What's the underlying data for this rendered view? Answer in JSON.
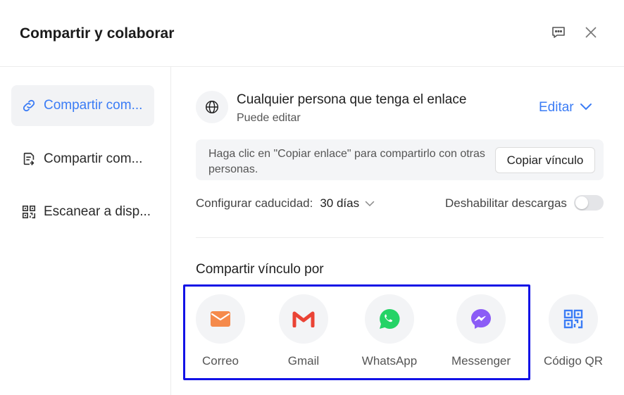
{
  "header": {
    "title": "Compartir y colaborar",
    "feedback_icon": "feedback-icon",
    "close_icon": "close-icon"
  },
  "sidebar": {
    "items": [
      {
        "label": "Compartir com...",
        "icon": "link-icon",
        "active": true
      },
      {
        "label": "Compartir com...",
        "icon": "file-share-icon",
        "active": false
      },
      {
        "label": "Escanear a disp...",
        "icon": "qr-icon",
        "active": false
      }
    ]
  },
  "access": {
    "title": "Cualquier persona que tenga el enlace",
    "permission": "Puede editar",
    "edit_label": "Editar"
  },
  "copy": {
    "hint": "Haga clic en \"Copiar enlace\" para compartirlo con otras personas.",
    "button": "Copiar vínculo"
  },
  "settings": {
    "expiry_label": "Configurar caducidad:",
    "expiry_value": "30 días",
    "downloads_label": "Deshabilitar descargas",
    "downloads_disabled": false
  },
  "share_via": {
    "title": "Compartir vínculo por",
    "options": [
      {
        "label": "Correo",
        "icon": "mail-icon"
      },
      {
        "label": "Gmail",
        "icon": "gmail-icon"
      },
      {
        "label": "WhatsApp",
        "icon": "whatsapp-icon"
      },
      {
        "label": "Messenger",
        "icon": "messenger-icon"
      },
      {
        "label": "Código QR",
        "icon": "qr-code-icon"
      }
    ]
  },
  "colors": {
    "accent": "#3b7cf5",
    "highlight_border": "#1212e6",
    "mail": "#f58a4b",
    "gmail": "#ea4335",
    "whatsapp": "#25d366",
    "messenger": "#8b5cf6"
  }
}
